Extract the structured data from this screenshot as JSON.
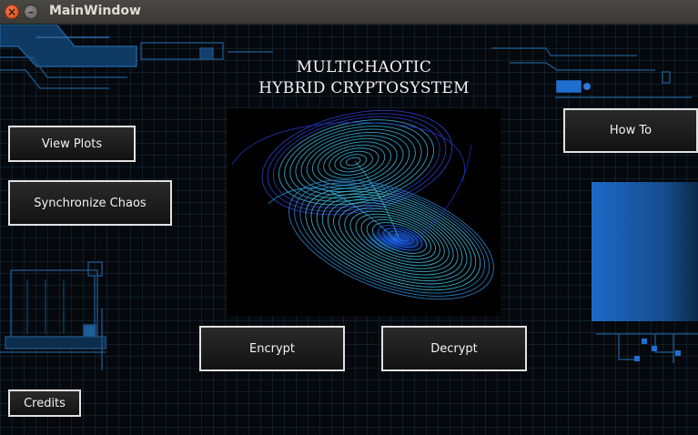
{
  "window": {
    "title": "MainWindow"
  },
  "app": {
    "title_line1": "MULTICHAOTIC",
    "title_line2": "HYBRID CRYPTOSYSTEM"
  },
  "buttons": {
    "view_plots": "View Plots",
    "synchronize_chaos": "Synchronize Chaos",
    "how_to": "How To",
    "encrypt": "Encrypt",
    "decrypt": "Decrypt",
    "credits": "Credits"
  },
  "colors": {
    "accent": "#1e6fd0",
    "grid": "#244a68",
    "button_border": "#e2e2e2",
    "attractor": "#3fb8e0"
  }
}
